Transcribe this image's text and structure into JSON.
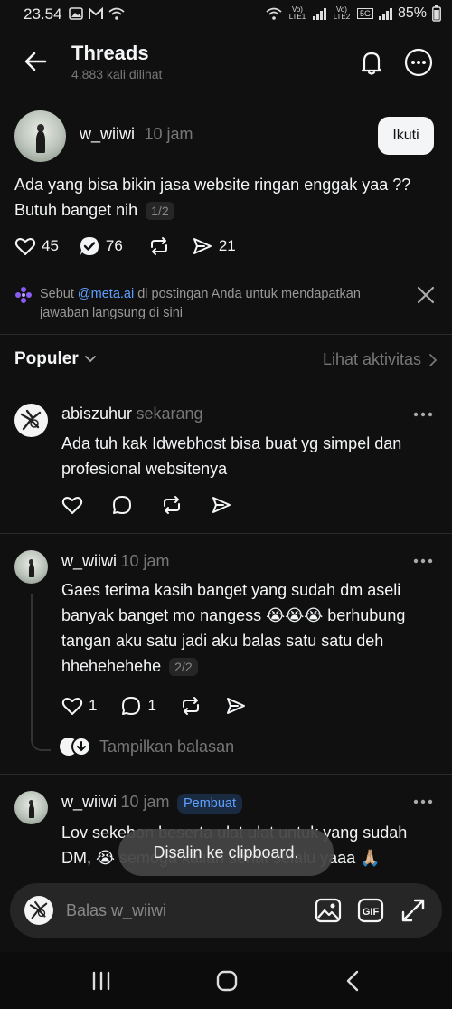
{
  "status": {
    "time": "23.54",
    "net1": "Vo) LTE1",
    "net2": "Vo) LTE2",
    "net5g": "5G",
    "battery": "85%"
  },
  "header": {
    "title": "Threads",
    "views": "4.883 kali dilihat"
  },
  "post": {
    "username": "w_wiiwi",
    "time": "10 jam",
    "follow_label": "Ikuti",
    "text": "Ada yang bisa bikin jasa website ringan enggak yaa ?? Butuh banget nih",
    "page": "1/2",
    "likes": "45",
    "reposts": "76",
    "shares": "21"
  },
  "ai_banner": {
    "prefix": "Sebut ",
    "mention": "@meta.ai",
    "suffix": " di postingan Anda untuk mendapatkan jawaban langsung di sini"
  },
  "sort": {
    "label": "Populer",
    "activity": "Lihat aktivitas"
  },
  "replies": [
    {
      "username": "abiszuhur",
      "time": "sekarang",
      "text": "Ada tuh kak Idwebhost bisa buat yg simpel dan profesional websitenya"
    },
    {
      "username": "w_wiiwi",
      "time": "10 jam",
      "text": "Gaes terima kasih banget yang sudah dm aseli banyak banget mo nangess 😭😭😭 berhubung tangan aku satu jadi aku balas satu satu deh hhehehehehe",
      "page": "2/2",
      "likes": "1",
      "comments": "1",
      "show_replies": "Tampilkan balasan"
    },
    {
      "username": "w_wiiwi",
      "time": "10 jam",
      "badge": "Pembuat",
      "text": "Lov sekebon beserta ulat ulat untuk yang sudah DM, 😭 semoga kalian sehat selalu yaaa 🙏🏼"
    }
  ],
  "toast": "Disalin ke clipboard.",
  "reply_bar": {
    "placeholder": "Balas w_wiiwi",
    "gif_label": "GIF"
  }
}
